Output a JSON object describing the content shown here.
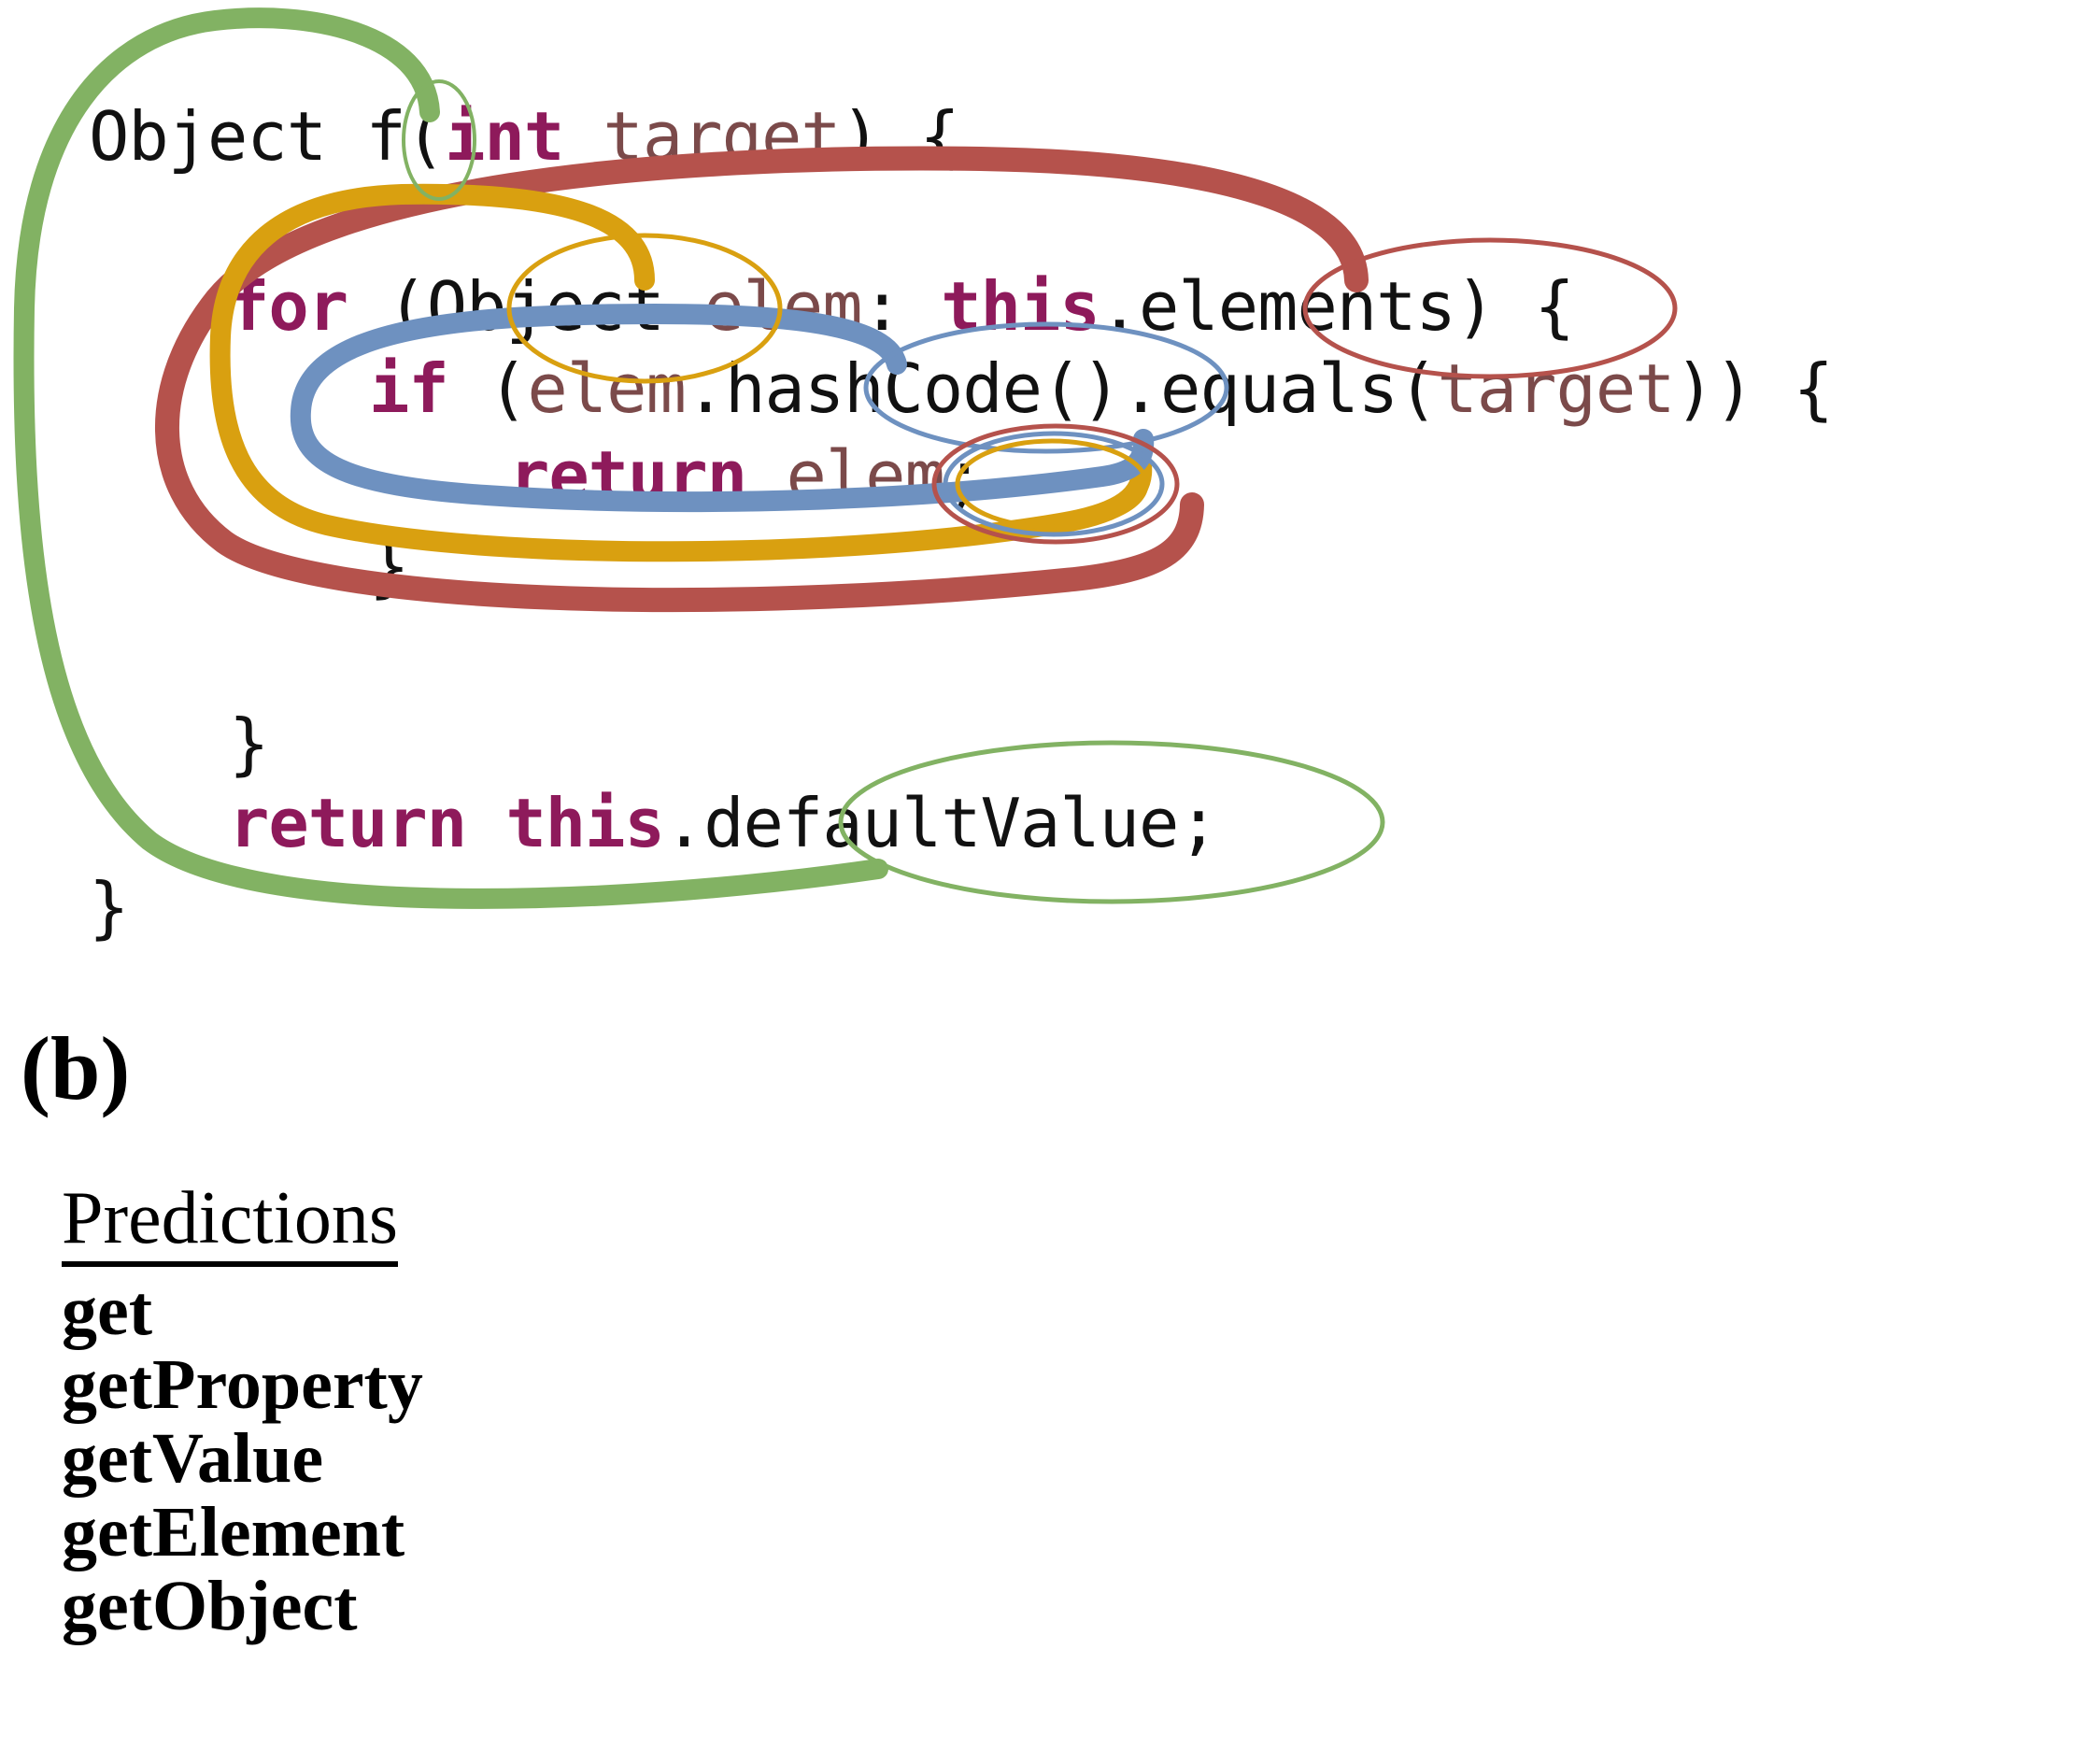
{
  "figure": {
    "panel_label": "(b)",
    "colors": {
      "arc_green": "#82B263",
      "arc_red": "#B5524C",
      "arc_orange": "#D9A010",
      "arc_blue": "#6E91C0",
      "keyword_purple": "#8E1A5B",
      "identifier_brown": "#7B4A4A",
      "code_black": "#111111",
      "background": "#FFFFFF"
    }
  },
  "code": {
    "language": "java",
    "lines": [
      {
        "id": "line-signature",
        "indent": 0,
        "tokens": [
          {
            "text": "Object ",
            "style": "plain"
          },
          {
            "text": "f",
            "style": "plain"
          },
          {
            "text": "(",
            "style": "punc"
          },
          {
            "text": "int",
            "style": "kw"
          },
          {
            "text": " target",
            "style": "ident"
          },
          {
            "text": ") {",
            "style": "punc"
          }
        ],
        "plain": "Object f(int target) {"
      },
      {
        "id": "line-for",
        "indent": 1,
        "tokens": [
          {
            "text": "for",
            "style": "kw"
          },
          {
            "text": " (",
            "style": "punc"
          },
          {
            "text": "Object",
            "style": "plain"
          },
          {
            "text": " elem",
            "style": "ident"
          },
          {
            "text": ": ",
            "style": "punc"
          },
          {
            "text": "this",
            "style": "kw"
          },
          {
            "text": ".",
            "style": "punc"
          },
          {
            "text": "elements",
            "style": "plain"
          },
          {
            "text": ") {",
            "style": "punc"
          }
        ],
        "plain": "for (Object elem: this.elements) {"
      },
      {
        "id": "line-if",
        "indent": 2,
        "tokens": [
          {
            "text": "if",
            "style": "kw"
          },
          {
            "text": " (",
            "style": "punc"
          },
          {
            "text": "elem",
            "style": "ident"
          },
          {
            "text": ".",
            "style": "punc"
          },
          {
            "text": "hashCode",
            "style": "plain"
          },
          {
            "text": "().",
            "style": "punc"
          },
          {
            "text": "equals",
            "style": "plain"
          },
          {
            "text": "(",
            "style": "punc"
          },
          {
            "text": "target",
            "style": "ident"
          },
          {
            "text": ")) {",
            "style": "punc"
          }
        ],
        "plain": "if (elem.hashCode().equals(target)) {"
      },
      {
        "id": "line-return-elem",
        "indent": 3,
        "tokens": [
          {
            "text": "return",
            "style": "kw"
          },
          {
            "text": " ",
            "style": "punc"
          },
          {
            "text": "elem",
            "style": "ident"
          },
          {
            "text": ";",
            "style": "punc"
          }
        ],
        "plain": "return elem;"
      },
      {
        "id": "line-close-if",
        "indent": 2,
        "tokens": [
          {
            "text": "}",
            "style": "punc"
          }
        ],
        "plain": "}"
      },
      {
        "id": "line-close-for",
        "indent": 1,
        "tokens": [
          {
            "text": "}",
            "style": "punc"
          }
        ],
        "plain": "}"
      },
      {
        "id": "line-return-default",
        "indent": 1,
        "tokens": [
          {
            "text": "return",
            "style": "kw"
          },
          {
            "text": " ",
            "style": "punc"
          },
          {
            "text": "this",
            "style": "kw"
          },
          {
            "text": ".",
            "style": "punc"
          },
          {
            "text": "defaultValue",
            "style": "plain"
          },
          {
            "text": ";",
            "style": "punc"
          }
        ],
        "plain": "return this.defaultValue;"
      },
      {
        "id": "line-close-method",
        "indent": 0,
        "tokens": [
          {
            "text": "}",
            "style": "punc"
          }
        ],
        "plain": "}"
      }
    ]
  },
  "annotations": {
    "ellipses": [
      {
        "id": "ellipse-f",
        "target_token": "f",
        "color": "#82B263"
      },
      {
        "id": "ellipse-object",
        "target_token": "Object",
        "color": "#D9A010"
      },
      {
        "id": "ellipse-elements",
        "target_token": "elements",
        "color": "#B5524C"
      },
      {
        "id": "ellipse-hashcode",
        "target_token": "hashCode",
        "color": "#6E91C0"
      },
      {
        "id": "ellipse-elem-red",
        "target_token": "elem",
        "color": "#B5524C"
      },
      {
        "id": "ellipse-elem-blue",
        "target_token": "elem",
        "color": "#6E91C0"
      },
      {
        "id": "ellipse-elem-orange",
        "target_token": "elem",
        "color": "#D9A010"
      },
      {
        "id": "ellipse-defaultvalue",
        "target_token": "defaultValue",
        "color": "#82B263"
      }
    ],
    "arcs": [
      {
        "id": "arc-green",
        "from": "f",
        "to": "defaultValue",
        "color": "#82B263"
      },
      {
        "id": "arc-red",
        "from": "elements",
        "to": "elem",
        "color": "#B5524C"
      },
      {
        "id": "arc-orange",
        "from": "Object",
        "to": "elem",
        "color": "#D9A010"
      },
      {
        "id": "arc-blue",
        "from": "hashCode",
        "to": "elem",
        "color": "#6E91C0"
      }
    ]
  },
  "predictions": {
    "heading": "Predictions",
    "items": [
      "get",
      "getProperty",
      "getValue",
      "getElement",
      "getObject"
    ]
  }
}
